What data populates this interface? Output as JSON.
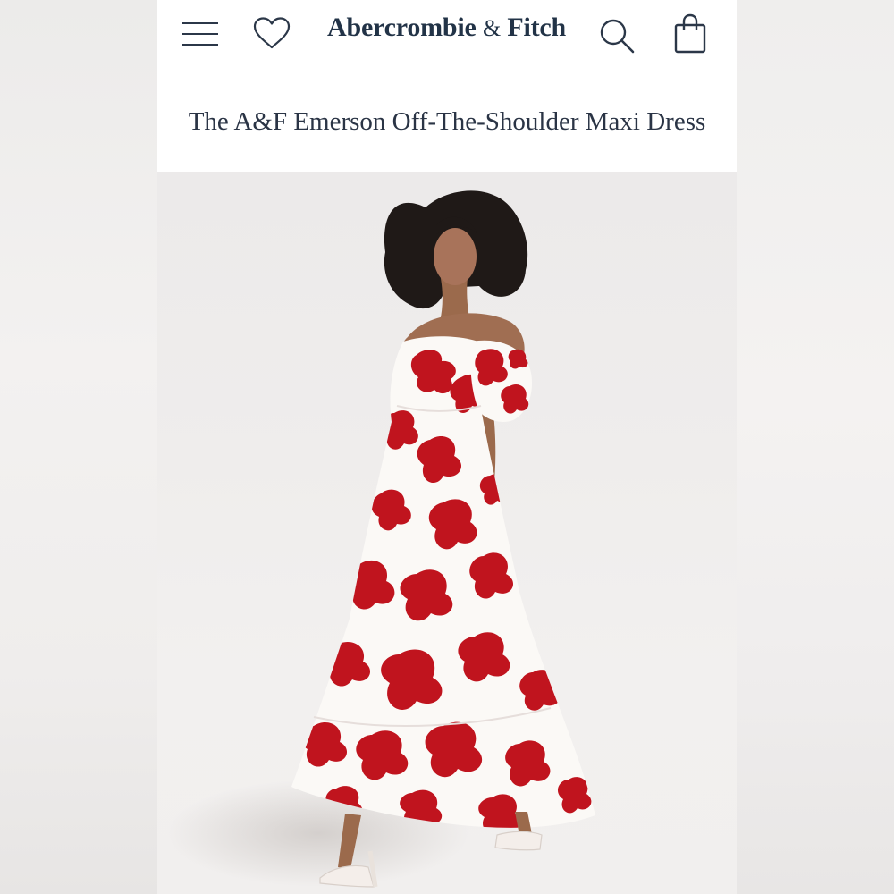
{
  "header": {
    "brand_name": "Abercrombie",
    "brand_amp": "&",
    "brand_name_2": "Fitch",
    "icons": [
      "menu-icon",
      "heart-icon",
      "search-icon",
      "shopping-bag-icon"
    ]
  },
  "product": {
    "title": "The A&F Emerson Off-The-Shoulder Maxi Dress"
  },
  "colors": {
    "brand_text": "#223347",
    "title_text": "#2a3445",
    "dress_red": "#c0141e",
    "dress_white": "#fbf9f6"
  }
}
